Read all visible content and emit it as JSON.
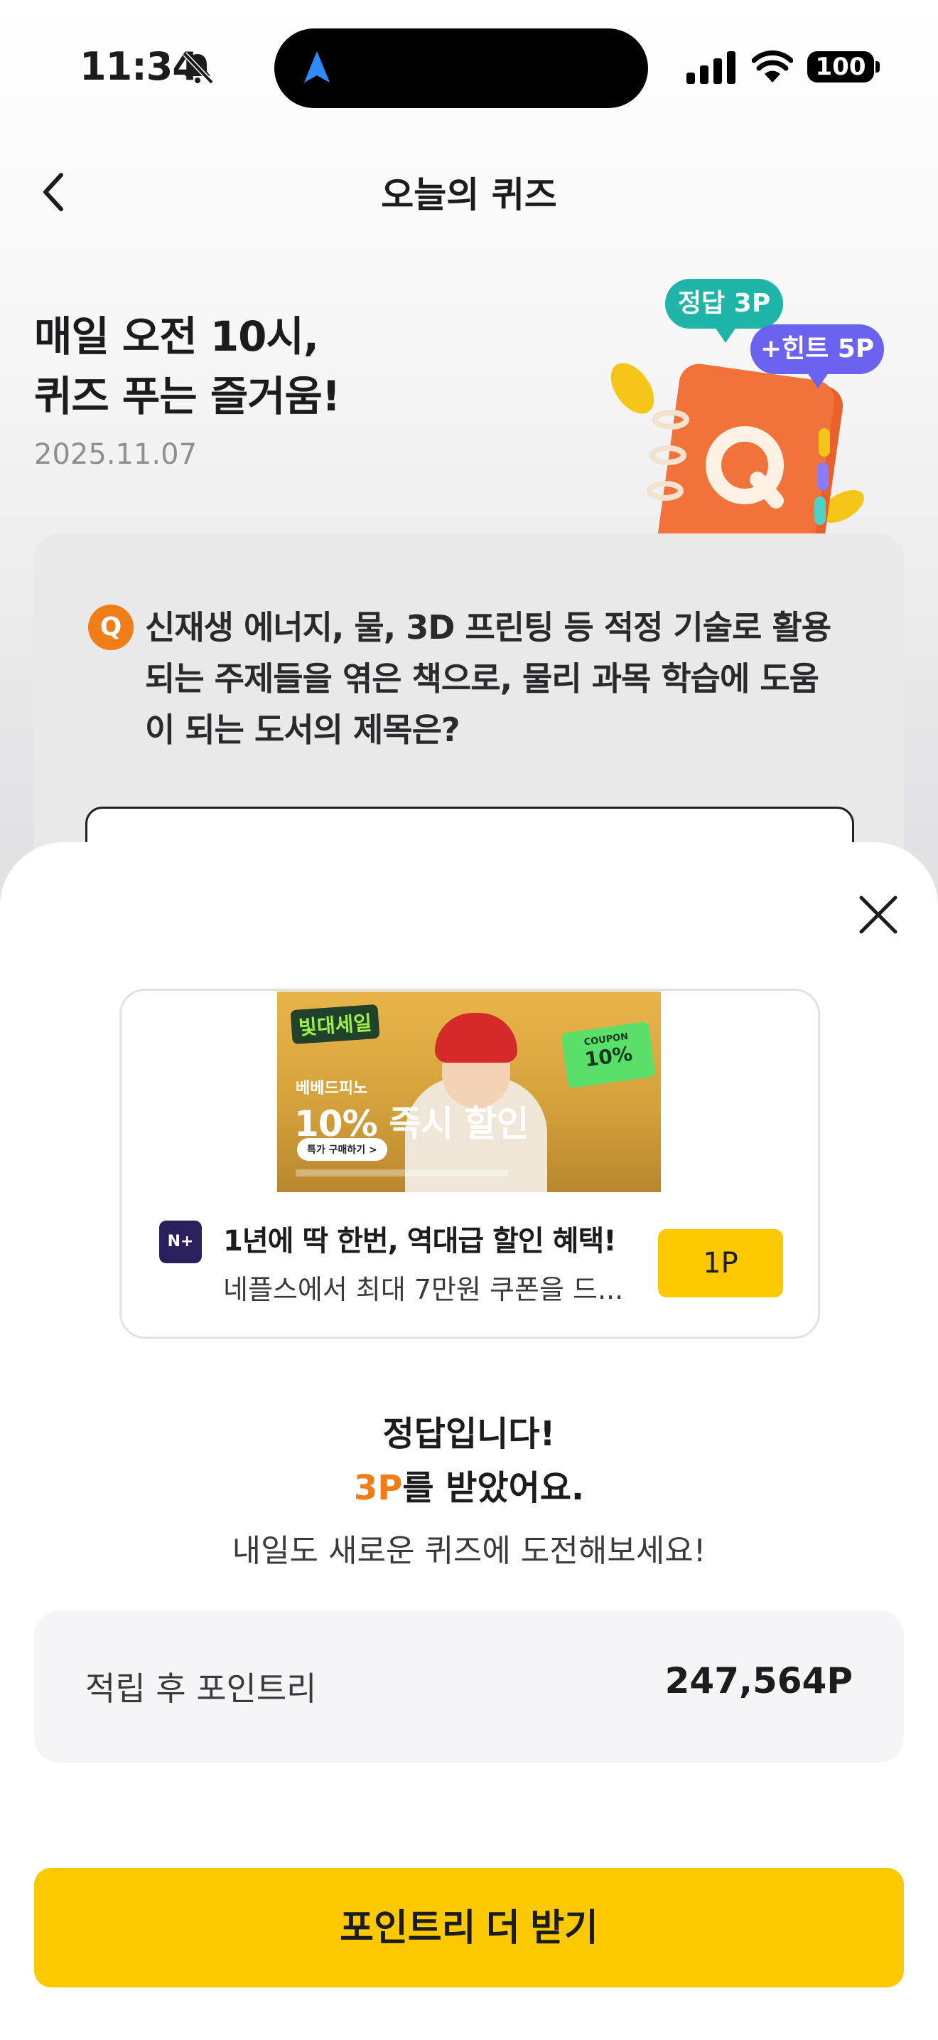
{
  "status_bar": {
    "time": "11:34",
    "battery": "100"
  },
  "header": {
    "title": "오늘의 퀴즈"
  },
  "hero": {
    "line1": "매일 오전 10시,",
    "line2": "퀴즈 푸는 즐거움!",
    "date": "2025.11.07",
    "badge_correct": "정답 3P",
    "badge_hint": "+힌트 5P"
  },
  "quiz": {
    "q_mark": "Q",
    "question_lines": [
      "신재생 에너지, 물, 3D 프린팅 등 적정 기술로 활용",
      "되는 주제들을 엮은 책으로, 물리 과목 학습에 도움",
      "이 되는 도서의 제목은?"
    ]
  },
  "ad": {
    "banner": {
      "logo": "빛대세일",
      "brand": "베베드피노",
      "discount": "10% 즉시 할인",
      "cta": "특가 구매하기 >",
      "coupon_label": "COUPON",
      "coupon_value": "10%"
    },
    "app_icon": "N+",
    "title": "1년에 딱 한번, 역대급 할인 혜택!",
    "description": "네플스에서 최대 7만원 쿠폰을 드...",
    "point_button": "1P"
  },
  "result": {
    "title": "정답입니다!",
    "points_value": "3P",
    "points_suffix": "를 받았어요.",
    "subtitle": "내일도 새로운 퀴즈에 도전해보세요!"
  },
  "total": {
    "label": "적립 후 포인트리",
    "value": "247,564P"
  },
  "cta": {
    "label": "포인트리 더 받기"
  },
  "colors": {
    "accent_yellow": "#fcc800",
    "accent_orange": "#f07d17",
    "badge_green": "#1fb4a8",
    "badge_purple": "#6b63f0"
  }
}
